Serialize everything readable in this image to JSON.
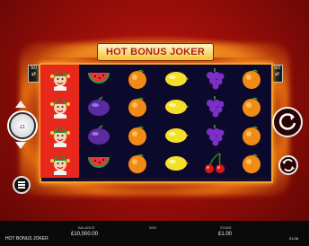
{
  "game": {
    "title": "HOT BONUS JOKER",
    "logo_text": "HOT BONUS JOKER"
  },
  "paylines": {
    "left": [
      "50",
      "⇄"
    ],
    "right": [
      "50",
      "⇄"
    ]
  },
  "bet_coin": {
    "value": "£1"
  },
  "reels": [
    [
      "joker",
      "joker",
      "joker",
      "joker"
    ],
    [
      "watermelon",
      "plum",
      "plum",
      "watermelon"
    ],
    [
      "orange",
      "orange",
      "orange",
      "orange"
    ],
    [
      "lemon",
      "lemon",
      "lemon",
      "lemon"
    ],
    [
      "grapes",
      "grapes",
      "grapes",
      "cherry"
    ],
    [
      "orange",
      "orange",
      "orange",
      "orange"
    ]
  ],
  "bottom_bar": {
    "game_name": "HOT BONUS JOKER",
    "balance_label": "BALANCE",
    "balance_value": "£10,000.00",
    "win_label": "WIN",
    "win_value": "",
    "stake_label": "STAKE",
    "stake_value": "£1.00",
    "clock": "21:08"
  },
  "colors": {
    "accent": "#f3a12a",
    "background": "#c4140e",
    "joker_reel": "#e8281c"
  },
  "icons": {
    "spin": "spin-arrow-icon",
    "autoplay": "autoplay-icon",
    "menu": "menu-icon"
  }
}
